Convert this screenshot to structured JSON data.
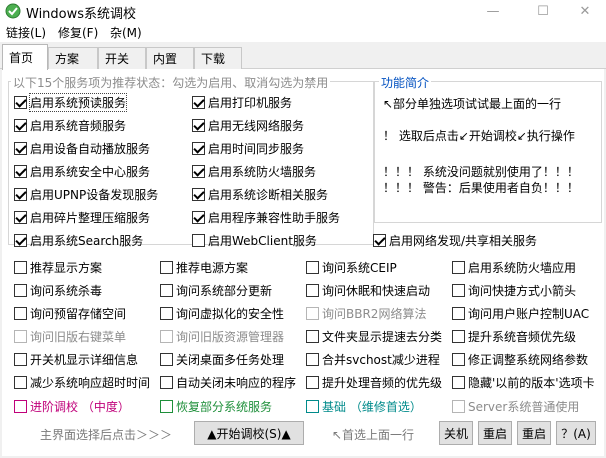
{
  "window": {
    "title": "Windows系统调校",
    "minimize": "—",
    "maximize": "☐",
    "close": "✕"
  },
  "menu": [
    "链接(L)",
    "修复(F)",
    "杂(M)"
  ],
  "tabs": [
    "首页",
    "方案",
    "开关",
    "内置",
    "下载"
  ],
  "group_title": "以下15个服务项为推荐状态：勾选为启用、取消勾选为禁用",
  "services": [
    {
      "label": "启用系统预读服务",
      "checked": true
    },
    {
      "label": "启用打印机服务",
      "checked": true
    },
    {
      "label": "启用系统音频服务",
      "checked": true
    },
    {
      "label": "启用无线网络服务",
      "checked": true
    },
    {
      "label": "启用设备自动播放服务",
      "checked": true
    },
    {
      "label": "启用时间同步服务",
      "checked": true
    },
    {
      "label": "启用系统安全中心服务",
      "checked": true
    },
    {
      "label": "启用系统防火墙服务",
      "checked": true
    },
    {
      "label": "启用UPNP设备发现服务",
      "checked": true
    },
    {
      "label": "启用系统诊断相关服务",
      "checked": true
    },
    {
      "label": "启用碎片整理压缩服务",
      "checked": true
    },
    {
      "label": "启用程序兼容性助手服务",
      "checked": true
    },
    {
      "label": "启用系统Search服务",
      "checked": true
    },
    {
      "label": "启用WebClient服务",
      "checked": false
    },
    {
      "label": "启用网络发现/共享相关服务",
      "checked": true
    }
  ],
  "info": {
    "title": "功能简介",
    "lines": [
      "↖部分单独选项试试最上面的一行",
      "！ 选取后点击↙开始调校↙执行操作",
      "！！！ 系统没问题就别使用了！！！",
      "！！！ 警告：后果使用者自负！！！"
    ]
  },
  "options": [
    {
      "label": "推荐显示方案",
      "checked": false,
      "disabled": false
    },
    {
      "label": "推荐电源方案",
      "checked": false,
      "disabled": false
    },
    {
      "label": "询问系统CEIP",
      "checked": false,
      "disabled": false
    },
    {
      "label": "启用系统防火墙应用",
      "checked": false,
      "disabled": false
    },
    {
      "label": "询问系统杀毒",
      "checked": false,
      "disabled": false
    },
    {
      "label": "询问系统部分更新",
      "checked": false,
      "disabled": false
    },
    {
      "label": "询问休眠和快速启动",
      "checked": false,
      "disabled": false
    },
    {
      "label": "询问快捷方式小箭头",
      "checked": false,
      "disabled": false
    },
    {
      "label": "询问预留存储空间",
      "checked": false,
      "disabled": false
    },
    {
      "label": "询问虚拟化的安全性",
      "checked": false,
      "disabled": false
    },
    {
      "label": "询问BBR2网络算法",
      "checked": false,
      "disabled": true
    },
    {
      "label": "询问用户账户控制UAC",
      "checked": false,
      "disabled": false
    },
    {
      "label": "询问旧版右键菜单",
      "checked": false,
      "disabled": true
    },
    {
      "label": "询问旧版资源管理器",
      "checked": false,
      "disabled": true
    },
    {
      "label": "文件夹显示提速去分类",
      "checked": false,
      "disabled": false
    },
    {
      "label": "提升系统音频优先级",
      "checked": false,
      "disabled": false
    },
    {
      "label": "开关机显示详细信息",
      "checked": false,
      "disabled": false
    },
    {
      "label": "关闭桌面多任务处理",
      "checked": false,
      "disabled": false
    },
    {
      "label": "合并svchost减少进程",
      "checked": false,
      "disabled": false
    },
    {
      "label": "修正调整系统网络参数",
      "checked": false,
      "disabled": false
    },
    {
      "label": "减少系统响应超时时间",
      "checked": false,
      "disabled": false
    },
    {
      "label": "自动关闭未响应的程序",
      "checked": false,
      "disabled": false
    },
    {
      "label": "提升处理音频的优先级",
      "checked": false,
      "disabled": false
    },
    {
      "label": "隐藏'以前的版本'选项卡",
      "checked": false,
      "disabled": false
    }
  ],
  "special": [
    {
      "label": "进阶调校 （中度）",
      "color": "#c0007a",
      "checked": false,
      "disabled": false
    },
    {
      "label": "恢复部分系统服务",
      "color": "#1e8f3a",
      "checked": false,
      "disabled": false
    },
    {
      "label": "基础 （维修首选）",
      "color": "#008b8b",
      "checked": false,
      "disabled": false
    },
    {
      "label": "Server系统普通使用",
      "color": "#8c8c8c",
      "checked": false,
      "disabled": true
    }
  ],
  "bottom": {
    "hint_left": "主界面选择后点击＞＞＞",
    "start_button": "▲开始调校(S)▲",
    "hint_mid": "↖首选上面一行",
    "buttons": [
      "关机",
      "重启",
      "重启",
      "？(A)"
    ]
  }
}
